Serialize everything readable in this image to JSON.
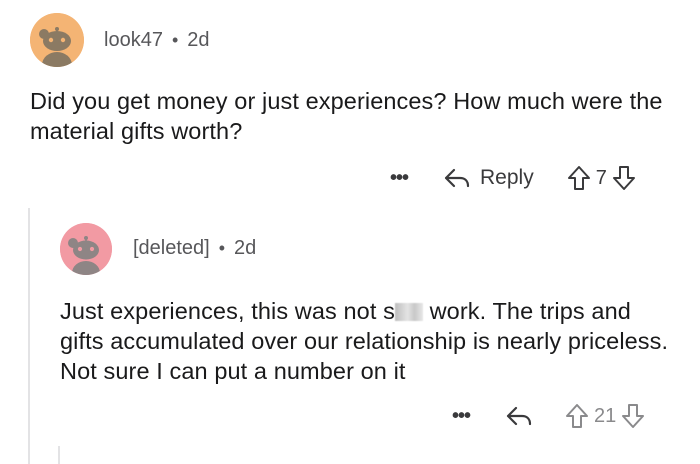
{
  "comment": {
    "username": "look47",
    "separator": "•",
    "age": "2d",
    "avatar_color": "#f4b474",
    "text": "Did you get money or just experiences? How much were the material gifts worth?",
    "more_label": "•••",
    "reply_label": "Reply",
    "vote_count": "7"
  },
  "reply": {
    "username": "[deleted]",
    "separator": "•",
    "age": "2d",
    "avatar_color": "#f29aa3",
    "text_before": "Just experiences, this was not s",
    "text_after": " work. The trips and gifts accumulated over our relationship is nearly priceless. Not sure I can put a number on it",
    "more_label": "•••",
    "vote_count": "21"
  },
  "icons": {
    "more": "more-dots-icon",
    "reply": "reply-arrow-icon",
    "upvote": "upvote-icon",
    "downvote": "downvote-icon"
  }
}
